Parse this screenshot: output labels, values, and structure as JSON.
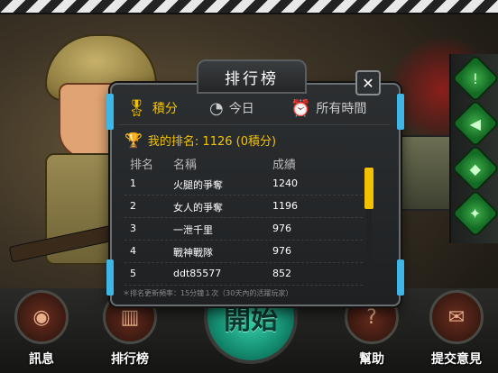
{
  "dialog": {
    "title": "排行榜",
    "close_label": "✕",
    "tabs": [
      {
        "label": "積分",
        "icon": "medal-icon"
      },
      {
        "label": "今日",
        "icon": "clock-24-icon"
      },
      {
        "label": "所有時間",
        "icon": "alarm-clock-icon"
      }
    ],
    "my_rank_text": "我的排名: 1126  (0積分)",
    "columns": [
      "排名",
      "名稱",
      "成績"
    ],
    "rows": [
      {
        "rank": "1",
        "name": "火腿的爭奪",
        "score": "1240"
      },
      {
        "rank": "2",
        "name": "女人的爭奪",
        "score": "1196"
      },
      {
        "rank": "3",
        "name": "一泄千里",
        "score": "976"
      },
      {
        "rank": "4",
        "name": "戰神戰隊",
        "score": "976"
      },
      {
        "rank": "5",
        "name": "ddt85577",
        "score": "852"
      }
    ],
    "footnote": "＊排名更新頻率：15分鐘１次（30天內的活躍玩家）"
  },
  "bottom_bar": {
    "items": [
      {
        "label": "訊息",
        "icon": "message-icon"
      },
      {
        "label": "排行榜",
        "icon": "leaderboard-icon"
      },
      {
        "label": "幫助",
        "icon": "help-icon"
      },
      {
        "label": "提交意見",
        "icon": "mail-icon"
      }
    ],
    "start_label": "開始"
  },
  "colors": {
    "accent": "#f2c200",
    "start_button": "#1fb08c",
    "side_buttons": "#2e9a3c"
  }
}
